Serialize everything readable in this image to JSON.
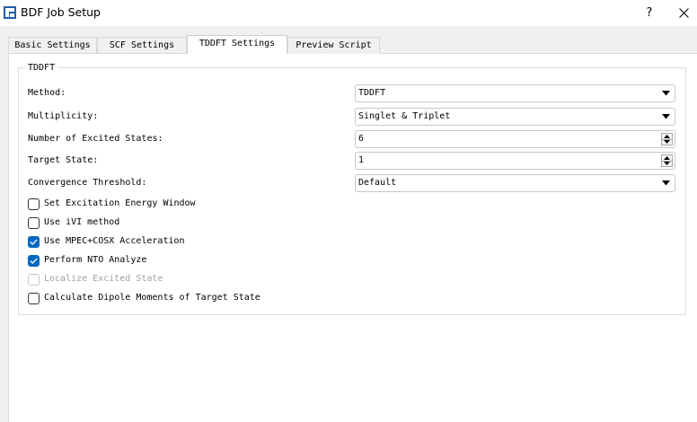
{
  "window": {
    "title": "BDF Job Setup",
    "help_label": "?",
    "icons": {
      "app": "bdf-app-icon",
      "close": "close-icon"
    }
  },
  "tabs": [
    {
      "label": "Basic Settings",
      "active": false
    },
    {
      "label": "SCF Settings",
      "active": false
    },
    {
      "label": "TDDFT Settings",
      "active": true
    },
    {
      "label": "Preview Script",
      "active": false
    }
  ],
  "group": {
    "title": "TDDFT",
    "method": {
      "label": "Method:",
      "value": "TDDFT"
    },
    "multiplicity": {
      "label": "Multiplicity:",
      "value": "Singlet & Triplet"
    },
    "excited_states": {
      "label": "Number of Excited States:",
      "value": "6"
    },
    "target_state": {
      "label": "Target State:",
      "value": "1"
    },
    "convergence": {
      "label": "Convergence Threshold:",
      "value": "Default"
    },
    "checkboxes": [
      {
        "label": "Set Excitation Energy Window",
        "checked": false,
        "enabled": true
      },
      {
        "label": "Use iVI method",
        "checked": false,
        "enabled": true
      },
      {
        "label": "Use MPEC+COSX Acceleration",
        "checked": true,
        "enabled": true
      },
      {
        "label": "Perform NTO Analyze",
        "checked": true,
        "enabled": true
      },
      {
        "label": "Localize Excited State",
        "checked": false,
        "enabled": false
      },
      {
        "label": "Calculate Dipole Moments of Target State",
        "checked": false,
        "enabled": true
      }
    ]
  },
  "colors": {
    "accent": "#0067c0",
    "window_bg": "#f0f0f0",
    "pane_bg": "#ffffff",
    "disabled_text": "#a0a0a0"
  }
}
